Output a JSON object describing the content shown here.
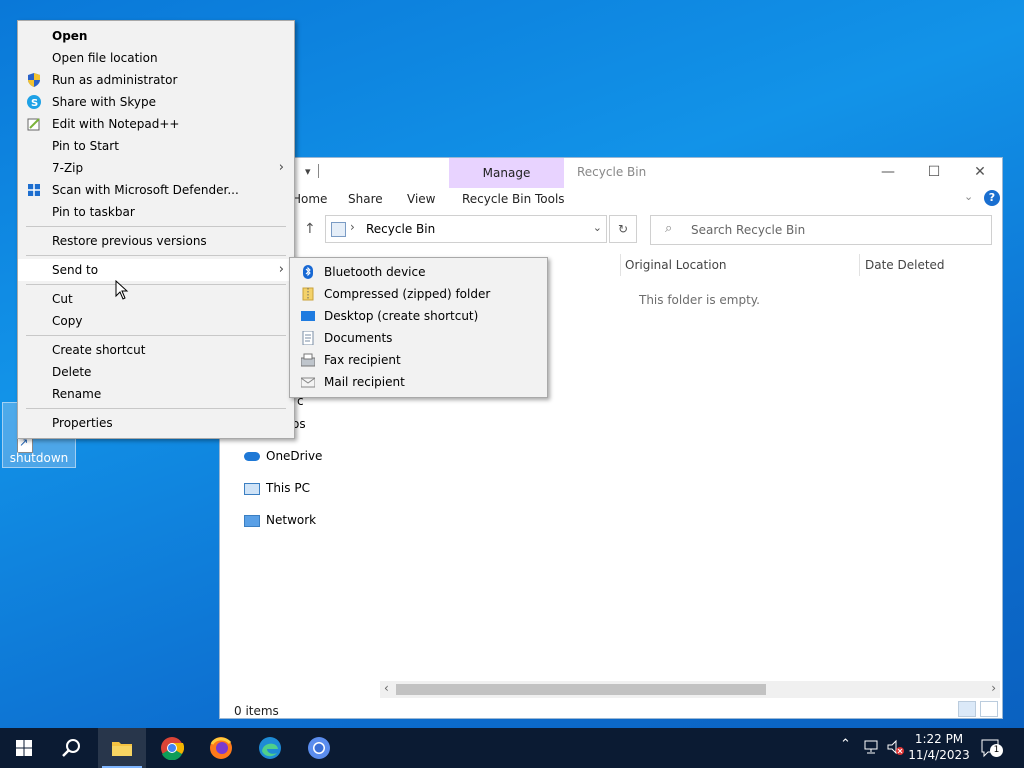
{
  "desktop": {
    "shutdown_label": "shutdown"
  },
  "explorer": {
    "title": "Recycle Bin",
    "manage_tab": "Manage",
    "tools_tab": "Recycle Bin Tools",
    "ribbon_tabs": [
      "Home",
      "Share",
      "View"
    ],
    "address_path": "Recycle Bin",
    "search_placeholder": "Search Recycle Bin",
    "columns": [
      "Original Location",
      "Date Deleted"
    ],
    "empty_message": "This folder is empty.",
    "nav_visible_fragments": [
      "c",
      "os"
    ],
    "nav_items": [
      "OneDrive",
      "This PC",
      "Network"
    ],
    "status_text": "0 items"
  },
  "context_menu": {
    "items": [
      {
        "label": "Open",
        "bold": true,
        "icon": ""
      },
      {
        "label": "Open file location",
        "icon": ""
      },
      {
        "label": "Run as administrator",
        "icon": "uac-shield-icon"
      },
      {
        "label": "Share with Skype",
        "icon": "skype-icon"
      },
      {
        "label": "Edit with Notepad++",
        "icon": "notepadpp-icon"
      },
      {
        "label": "Pin to Start",
        "icon": ""
      },
      {
        "label": "7-Zip",
        "icon": "",
        "submenu": true
      },
      {
        "label": "Scan with Microsoft Defender...",
        "icon": "defender-icon"
      },
      {
        "label": "Pin to taskbar",
        "icon": ""
      },
      {
        "label": "Restore previous versions",
        "icon": ""
      },
      {
        "label": "Send to",
        "icon": "",
        "submenu": true,
        "highlighted": true
      },
      {
        "label": "Cut",
        "icon": ""
      },
      {
        "label": "Copy",
        "icon": ""
      },
      {
        "label": "Create shortcut",
        "icon": ""
      },
      {
        "label": "Delete",
        "icon": ""
      },
      {
        "label": "Rename",
        "icon": ""
      },
      {
        "label": "Properties",
        "icon": ""
      }
    ]
  },
  "send_to_menu": {
    "items": [
      {
        "label": "Bluetooth device",
        "icon": "bluetooth-icon"
      },
      {
        "label": "Compressed (zipped) folder",
        "icon": "zip-folder-icon"
      },
      {
        "label": "Desktop (create shortcut)",
        "icon": "desktop-icon"
      },
      {
        "label": "Documents",
        "icon": "documents-icon"
      },
      {
        "label": "Fax recipient",
        "icon": "fax-icon"
      },
      {
        "label": "Mail recipient",
        "icon": "mail-icon"
      }
    ]
  },
  "taskbar": {
    "apps": [
      "start-icon",
      "search-icon",
      "file-explorer-icon",
      "chrome-icon",
      "firefox-icon",
      "edge-icon",
      "chromium-icon"
    ],
    "time": "1:22 PM",
    "date": "11/4/2023",
    "notification_count": "1"
  },
  "colors": {
    "desktop_blue": "#0a78d8",
    "taskbar": "#0b1b33",
    "manage_tab": "#e8d3ff",
    "menu_bg": "#f2f2f2"
  }
}
